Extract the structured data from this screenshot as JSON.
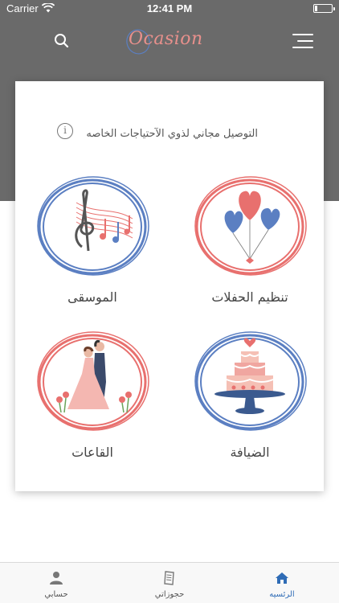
{
  "status_bar": {
    "carrier": "Carrier",
    "time": "12:41 PM",
    "battery_level": 0.15
  },
  "header": {
    "brand_name": "Ocasion"
  },
  "notice": {
    "text": "التوصيل مجاني لذوي الآحتياجات الخاصه",
    "info_glyph": "i"
  },
  "services": {
    "parties": {
      "label": "تنظيم الحفلات",
      "ring_color": "#e8706e",
      "icon": "balloons-icon"
    },
    "music": {
      "label": "الموسقى",
      "ring_color": "#5b7fc2",
      "icon": "music-notes-icon"
    },
    "catering": {
      "label": "الضيافة",
      "ring_color": "#5b7fc2",
      "icon": "cake-icon"
    },
    "halls": {
      "label": "القاعات",
      "ring_color": "#e8706e",
      "icon": "wedding-couple-icon"
    }
  },
  "tabbar": {
    "home": "الرئسيه",
    "bookings": "حجوزاتي",
    "account": "حسابي",
    "active_color": "#2f6cb6"
  }
}
